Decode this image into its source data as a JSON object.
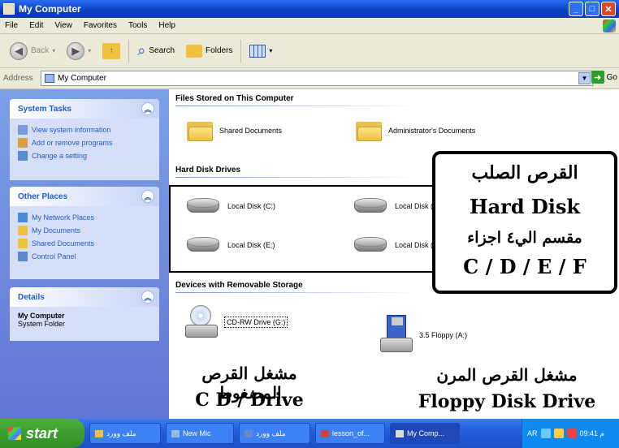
{
  "window": {
    "title": "My Computer"
  },
  "menu": [
    "File",
    "Edit",
    "View",
    "Favorites",
    "Tools",
    "Help"
  ],
  "toolbar": {
    "back": "Back",
    "search": "Search",
    "folders": "Folders"
  },
  "address": {
    "label": "Address",
    "value": "My Computer",
    "go": "Go"
  },
  "left": {
    "system_tasks": {
      "title": "System Tasks",
      "items": [
        "View system information",
        "Add or remove programs",
        "Change a setting"
      ]
    },
    "other_places": {
      "title": "Other Places",
      "items": [
        "My Network Places",
        "My Documents",
        "Shared Documents",
        "Control Panel"
      ]
    },
    "details": {
      "title": "Details",
      "name": "My Computer",
      "type": "System Folder"
    }
  },
  "sections": {
    "files": "Files Stored on This Computer",
    "hdd": "Hard Disk Drives",
    "removable": "Devices with Removable Storage"
  },
  "folders": [
    "Shared Documents",
    "Administrator's Documents"
  ],
  "disks": [
    "Local Disk (C:)",
    "Local Disk (D:)",
    "Local Disk (E:)",
    "Local Disk (F:)"
  ],
  "removable": {
    "cd": "CD-RW Drive (G:)",
    "floppy": "3.5 Floppy (A:)"
  },
  "annotations": {
    "hdd_ar": "القرص الصلب",
    "hdd_en": "Hard Disk",
    "hdd_parts": "مقسم الي٤ اجزاء",
    "hdd_letters": "C / D / E / F",
    "cd_ar": "مشغل القرص المضغوط",
    "cd_en": "C D / Drive",
    "floppy_ar": "مشغل القرص المرن",
    "floppy_en": "Floppy Disk Drive"
  },
  "taskbar": {
    "start": "start",
    "tasks": [
      "ملف وورد",
      "New Mic",
      "ملف وورد",
      "lesson_of...",
      "My Comp..."
    ],
    "lang": "AR",
    "clock": "09:41 م"
  }
}
